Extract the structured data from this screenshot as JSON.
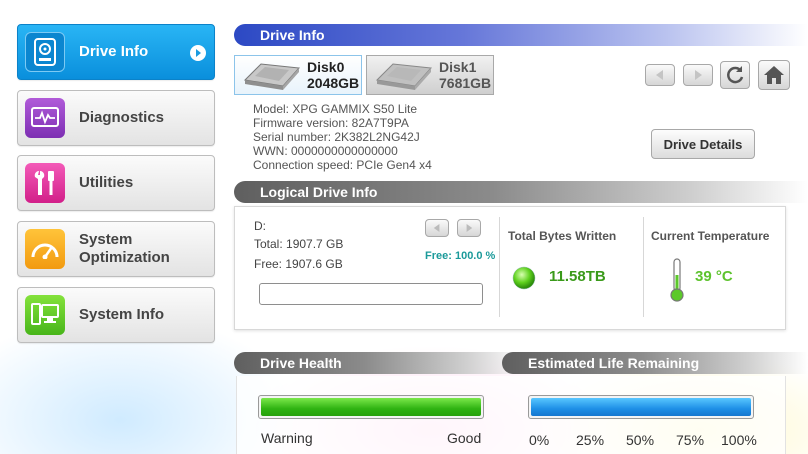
{
  "sidebar": {
    "items": [
      {
        "label": "Drive Info"
      },
      {
        "label": "Diagnostics"
      },
      {
        "label": "Utilities"
      },
      {
        "label_line1": "System",
        "label_line2": "Optimization"
      },
      {
        "label": "System Info"
      }
    ]
  },
  "drive_info": {
    "header": "Drive Info",
    "disks": [
      {
        "name": "Disk0",
        "size": "2048GB"
      },
      {
        "name": "Disk1",
        "size": "7681GB"
      }
    ],
    "model": "Model: XPG GAMMIX S50 Lite",
    "firmware": "Firmware version: 82A7T9PA",
    "serial": "Serial number: 2K382L2NG42J",
    "wwn": "WWN: 0000000000000000",
    "connection": "Connection speed: PCIe Gen4 x4",
    "details_button": "Drive Details"
  },
  "logical": {
    "header": "Logical Drive Info",
    "drive_letter": "D:",
    "total": "Total: 1907.7 GB",
    "free": "Free: 1907.6 GB",
    "free_percent": "Free: 100.0 %",
    "tbw_label": "Total Bytes Written",
    "tbw_value": "11.58TB",
    "temp_label": "Current Temperature",
    "temp_value": "39 °C"
  },
  "health": {
    "header": "Drive Health",
    "low_label": "Warning",
    "high_label": "Good",
    "level": 1.0
  },
  "life": {
    "header": "Estimated Life Remaining",
    "ticks": [
      "0%",
      "25%",
      "50%",
      "75%",
      "100%"
    ],
    "level": 1.0
  },
  "colors": {
    "accent_blue": "#1aa3e8",
    "health_green": "#39c21a",
    "life_blue": "#1e8fe6",
    "value_green": "#3a9a1a",
    "percent_teal": "#1b9a9a"
  }
}
